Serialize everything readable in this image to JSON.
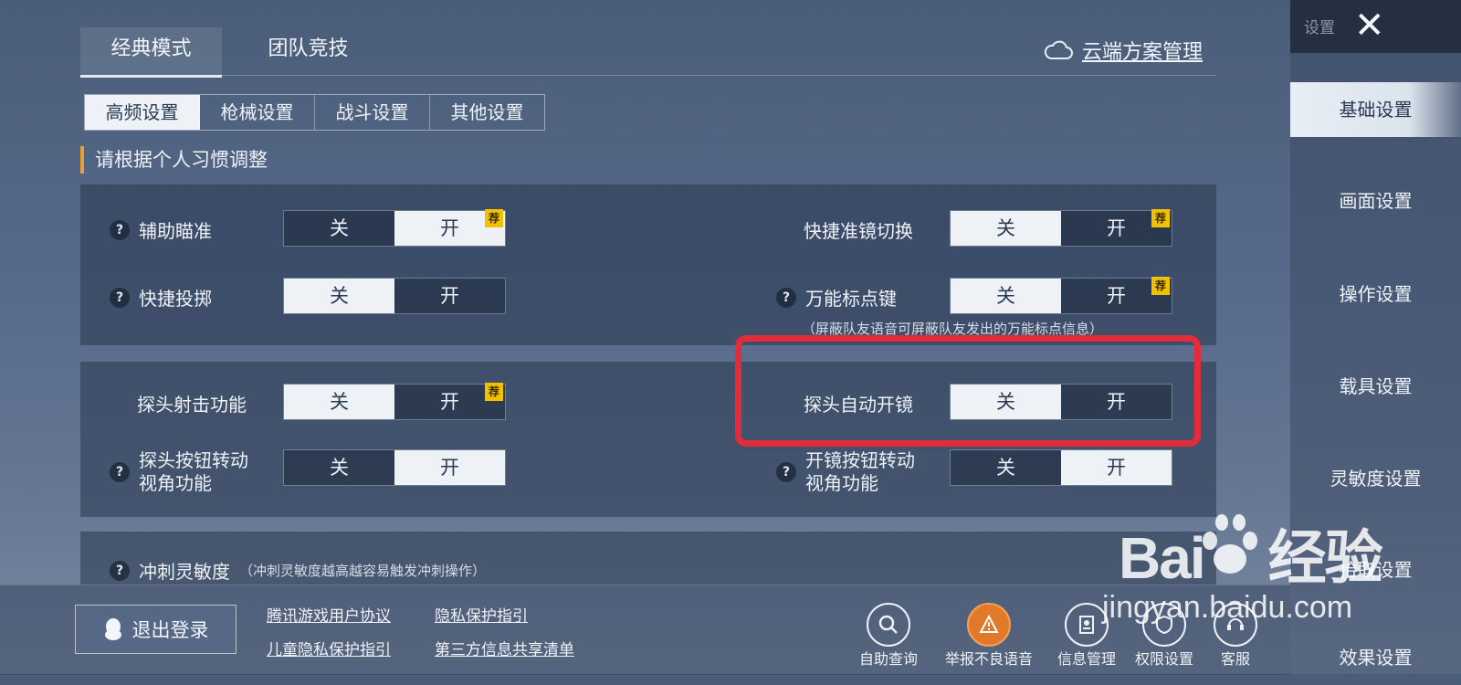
{
  "mode_tabs": [
    "经典模式",
    "团队竞技"
  ],
  "cloud_label": "云端方案管理",
  "sub_tabs": [
    "高频设置",
    "枪械设置",
    "战斗设置",
    "其他设置"
  ],
  "hint": "请根据个人习惯调整",
  "rec_badge": "荐",
  "toggle_off": "关",
  "toggle_on": "开",
  "settings": {
    "aim_assist": {
      "label": "辅助瞄准",
      "value": "开",
      "recommended": true
    },
    "quick_scope_switch": {
      "label": "快捷准镜切换",
      "value": "关",
      "recommended": true
    },
    "quick_throw": {
      "label": "快捷投掷",
      "value": "关"
    },
    "universal_marker": {
      "label": "万能标点键",
      "value": "关",
      "recommended": true
    },
    "marker_note": "（屏蔽队友语音可屏蔽队友发出的万能标点信息）",
    "peek_shoot": {
      "label": "探头射击功能",
      "value": "关",
      "recommended": true
    },
    "peek_auto_scope": {
      "label": "探头自动开镜",
      "value": "关"
    },
    "peek_btn_rotate": {
      "label1": "探头按钮转动",
      "label2": "视角功能",
      "value": "开"
    },
    "scope_btn_rotate": {
      "label1": "开镜按钮转动",
      "label2": "视角功能",
      "value": "开"
    },
    "sprint_sens": {
      "label": "冲刺灵敏度",
      "note": "（冲刺灵敏度越高越容易触发冲刺操作）"
    }
  },
  "sidebar": {
    "title": "设置",
    "items": [
      "基础设置",
      "画面设置",
      "操作设置",
      "载具设置",
      "灵敏度设置",
      "拾取设置",
      "效果设置"
    ]
  },
  "bottom": {
    "logout": "退出登录",
    "links": [
      "腾讯游戏用户协议",
      "隐私保护指引",
      "儿童隐私保护指引",
      "第三方信息共享清单"
    ],
    "icons": [
      {
        "name": "search-icon",
        "label": "自助查询"
      },
      {
        "name": "report-icon",
        "label": "举报不良语音"
      },
      {
        "name": "id-card-icon",
        "label": "信息管理"
      },
      {
        "name": "permission-icon",
        "label": "权限设置"
      },
      {
        "name": "support-icon",
        "label": "客服"
      }
    ]
  },
  "watermark": {
    "brand": "Bai",
    "brand2": "经验",
    "url": "jingyan.baidu.com"
  }
}
